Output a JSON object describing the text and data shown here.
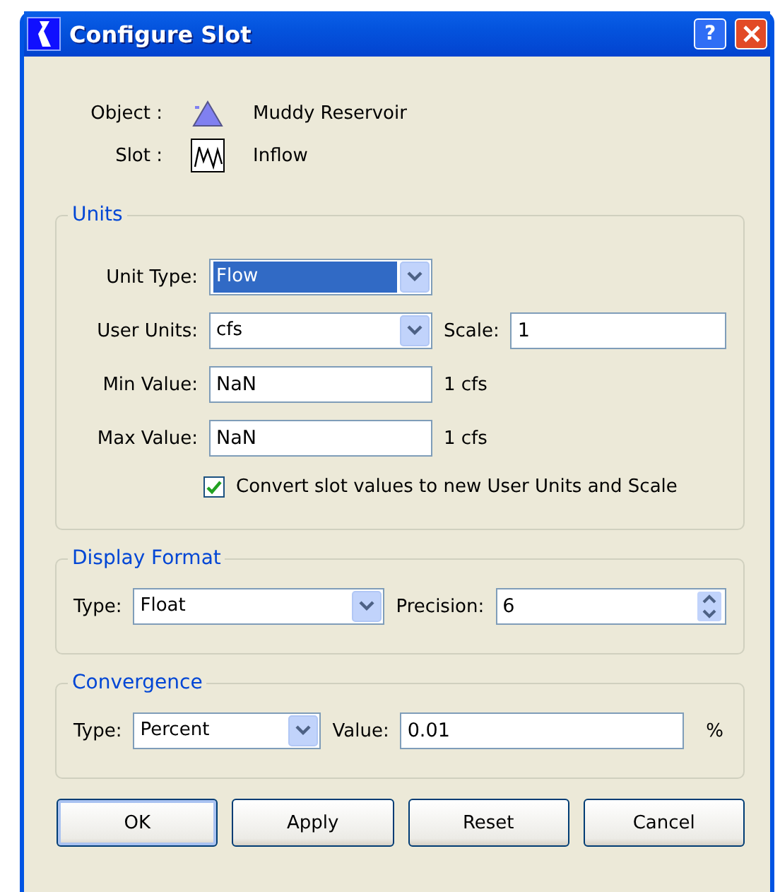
{
  "window": {
    "title": "Configure Slot",
    "help": "?"
  },
  "info": [
    {
      "label": "Object :",
      "kind": "reservoir",
      "value": "Muddy Reservoir"
    },
    {
      "label": "Slot :",
      "kind": "series",
      "value": "Inflow"
    }
  ],
  "units": {
    "title": "Units",
    "rows": [
      {
        "kind": "combo",
        "label": "Unit Type:",
        "value": "Flow",
        "highlighted": true
      },
      {
        "kind": "combo",
        "label": "User Units:",
        "value": "cfs",
        "highlighted": false,
        "extra_label": "Scale:",
        "extra_value": "1"
      },
      {
        "kind": "text",
        "label": "Min Value:",
        "value": "NaN",
        "unit": "1 cfs"
      },
      {
        "kind": "text",
        "label": "Max Value:",
        "value": "NaN",
        "unit": "1 cfs"
      }
    ],
    "checkbox": {
      "label": "Convert slot values to new User Units and Scale",
      "checked": true
    }
  },
  "display_format": {
    "title": "Display Format",
    "type_label": "Type:",
    "type_value": "Float",
    "precision_label": "Precision:",
    "precision_value": "6"
  },
  "convergence": {
    "title": "Convergence",
    "type_label": "Type:",
    "type_value": "Percent",
    "value_label": "Value:",
    "value": "0.01",
    "unit": "%"
  },
  "buttons": [
    {
      "label": "OK",
      "default": true
    },
    {
      "label": "Apply",
      "default": false
    },
    {
      "label": "Reset",
      "default": false
    },
    {
      "label": "Cancel",
      "default": false
    }
  ]
}
